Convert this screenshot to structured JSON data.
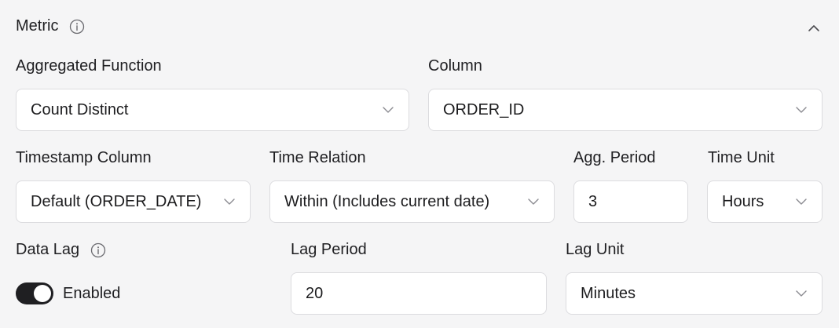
{
  "section": {
    "title": "Metric"
  },
  "aggregated_function": {
    "label": "Aggregated Function",
    "value": "Count Distinct"
  },
  "column": {
    "label": "Column",
    "value": "ORDER_ID"
  },
  "timestamp_column": {
    "label": "Timestamp Column",
    "value": "Default (ORDER_DATE)"
  },
  "time_relation": {
    "label": "Time Relation",
    "value": "Within (Includes current date)"
  },
  "agg_period": {
    "label": "Agg. Period",
    "value": "3"
  },
  "time_unit": {
    "label": "Time Unit",
    "value": "Hours"
  },
  "data_lag": {
    "label": "Data Lag",
    "toggle_label": "Enabled",
    "enabled": true
  },
  "lag_period": {
    "label": "Lag Period",
    "value": "20"
  },
  "lag_unit": {
    "label": "Lag Unit",
    "value": "Minutes"
  },
  "icons": {
    "info": "info-icon",
    "collapse": "chevron-up-icon",
    "dropdown": "chevron-down-icon"
  }
}
